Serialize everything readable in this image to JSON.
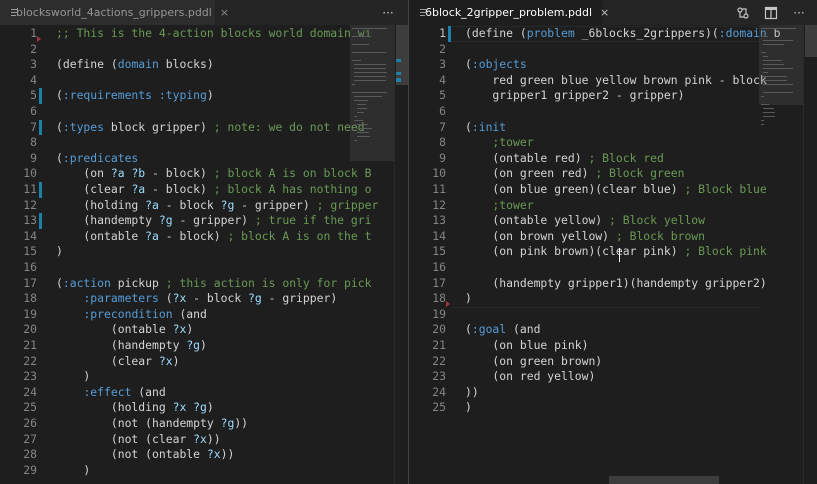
{
  "left_editor": {
    "tab": {
      "filename": "blocksworld_4actions_grippers.pddl",
      "close_icon": "×",
      "active": false
    },
    "more_actions": "···",
    "lines": [
      {
        "n": "1",
        "tokens": [
          {
            "t": ";; This is the 4-action blocks world domain wi",
            "c": "c"
          }
        ]
      },
      {
        "n": "2",
        "tokens": []
      },
      {
        "n": "3",
        "tokens": [
          {
            "t": "(define (",
            "c": ""
          },
          {
            "t": "domain",
            "c": "k"
          },
          {
            "t": " blocks)",
            "c": ""
          }
        ]
      },
      {
        "n": "4",
        "tokens": []
      },
      {
        "n": "5",
        "tokens": [
          {
            "t": "(",
            "c": ""
          },
          {
            "t": ":requirements",
            "c": "k"
          },
          {
            "t": " ",
            "c": ""
          },
          {
            "t": ":typing",
            "c": "k"
          },
          {
            "t": ")",
            "c": ""
          }
        ]
      },
      {
        "n": "6",
        "tokens": []
      },
      {
        "n": "7",
        "tokens": [
          {
            "t": "(",
            "c": ""
          },
          {
            "t": ":types",
            "c": "k"
          },
          {
            "t": " block gripper) ",
            "c": ""
          },
          {
            "t": "; note: we do not need",
            "c": "c"
          }
        ]
      },
      {
        "n": "8",
        "tokens": []
      },
      {
        "n": "9",
        "tokens": [
          {
            "t": "(",
            "c": ""
          },
          {
            "t": ":predicates",
            "c": "k"
          }
        ]
      },
      {
        "n": "10",
        "tokens": [
          {
            "t": "    (on ",
            "c": ""
          },
          {
            "t": "?a",
            "c": "s"
          },
          {
            "t": " ",
            "c": ""
          },
          {
            "t": "?b",
            "c": "s"
          },
          {
            "t": " - block) ",
            "c": ""
          },
          {
            "t": "; block A is on block B",
            "c": "c"
          }
        ]
      },
      {
        "n": "11",
        "tokens": [
          {
            "t": "    (clear ",
            "c": ""
          },
          {
            "t": "?a",
            "c": "s"
          },
          {
            "t": " - block) ",
            "c": ""
          },
          {
            "t": "; block A has nothing o",
            "c": "c"
          }
        ]
      },
      {
        "n": "12",
        "tokens": [
          {
            "t": "    (holding ",
            "c": ""
          },
          {
            "t": "?a",
            "c": "s"
          },
          {
            "t": " - block ",
            "c": ""
          },
          {
            "t": "?g",
            "c": "s"
          },
          {
            "t": " - gripper) ",
            "c": ""
          },
          {
            "t": "; gripper",
            "c": "c"
          }
        ]
      },
      {
        "n": "13",
        "tokens": [
          {
            "t": "    (handempty ",
            "c": ""
          },
          {
            "t": "?g",
            "c": "s"
          },
          {
            "t": " - gripper) ",
            "c": ""
          },
          {
            "t": "; true if the gri",
            "c": "c"
          }
        ]
      },
      {
        "n": "14",
        "tokens": [
          {
            "t": "    (ontable ",
            "c": ""
          },
          {
            "t": "?a",
            "c": "s"
          },
          {
            "t": " - block) ",
            "c": ""
          },
          {
            "t": "; block A is on the t",
            "c": "c"
          }
        ]
      },
      {
        "n": "15",
        "tokens": [
          {
            "t": ")",
            "c": ""
          }
        ]
      },
      {
        "n": "16",
        "tokens": []
      },
      {
        "n": "17",
        "tokens": [
          {
            "t": "(",
            "c": ""
          },
          {
            "t": ":action",
            "c": "k"
          },
          {
            "t": " pickup ",
            "c": ""
          },
          {
            "t": "; this action is only for pick",
            "c": "c"
          }
        ]
      },
      {
        "n": "18",
        "tokens": [
          {
            "t": "    ",
            "c": ""
          },
          {
            "t": ":parameters",
            "c": "k"
          },
          {
            "t": " (",
            "c": ""
          },
          {
            "t": "?x",
            "c": "s"
          },
          {
            "t": " - block ",
            "c": ""
          },
          {
            "t": "?g",
            "c": "s"
          },
          {
            "t": " - gripper)",
            "c": ""
          }
        ]
      },
      {
        "n": "19",
        "tokens": [
          {
            "t": "    ",
            "c": ""
          },
          {
            "t": ":precondition",
            "c": "k"
          },
          {
            "t": " (and",
            "c": ""
          }
        ]
      },
      {
        "n": "20",
        "tokens": [
          {
            "t": "        (ontable ",
            "c": ""
          },
          {
            "t": "?x",
            "c": "s"
          },
          {
            "t": ")",
            "c": ""
          }
        ]
      },
      {
        "n": "21",
        "tokens": [
          {
            "t": "        (handempty ",
            "c": ""
          },
          {
            "t": "?g",
            "c": "s"
          },
          {
            "t": ")",
            "c": ""
          }
        ]
      },
      {
        "n": "22",
        "tokens": [
          {
            "t": "        (clear ",
            "c": ""
          },
          {
            "t": "?x",
            "c": "s"
          },
          {
            "t": ")",
            "c": ""
          }
        ]
      },
      {
        "n": "23",
        "tokens": [
          {
            "t": "    )",
            "c": ""
          }
        ]
      },
      {
        "n": "24",
        "tokens": [
          {
            "t": "    ",
            "c": ""
          },
          {
            "t": ":effect",
            "c": "k"
          },
          {
            "t": " (and",
            "c": ""
          }
        ]
      },
      {
        "n": "25",
        "tokens": [
          {
            "t": "        (holding ",
            "c": ""
          },
          {
            "t": "?x",
            "c": "s"
          },
          {
            "t": " ",
            "c": ""
          },
          {
            "t": "?g",
            "c": "s"
          },
          {
            "t": ")",
            "c": ""
          }
        ]
      },
      {
        "n": "26",
        "tokens": [
          {
            "t": "        (not (handempty ",
            "c": ""
          },
          {
            "t": "?g",
            "c": "s"
          },
          {
            "t": "))",
            "c": ""
          }
        ]
      },
      {
        "n": "27",
        "tokens": [
          {
            "t": "        (not (clear ",
            "c": ""
          },
          {
            "t": "?x",
            "c": "s"
          },
          {
            "t": "))",
            "c": ""
          }
        ]
      },
      {
        "n": "28",
        "tokens": [
          {
            "t": "        (not (ontable ",
            "c": ""
          },
          {
            "t": "?x",
            "c": "s"
          },
          {
            "t": "))",
            "c": ""
          }
        ]
      },
      {
        "n": "29",
        "tokens": [
          {
            "t": "    )",
            "c": ""
          }
        ]
      }
    ]
  },
  "right_editor": {
    "tab": {
      "filename": "6block_2gripper_problem.pddl",
      "close_icon": "×",
      "active": true
    },
    "actions": {
      "open_changes_icon": "open-changes-icon",
      "split_editor_icon": "split-editor-icon",
      "more": "···"
    },
    "lines": [
      {
        "n": "1",
        "tokens": [
          {
            "t": "(define (",
            "c": ""
          },
          {
            "t": "problem",
            "c": "k"
          },
          {
            "t": " _6blocks_2grippers)(",
            "c": ""
          },
          {
            "t": ":domain",
            "c": "k"
          },
          {
            "t": " b",
            "c": ""
          }
        ]
      },
      {
        "n": "2",
        "tokens": []
      },
      {
        "n": "3",
        "tokens": [
          {
            "t": "(",
            "c": ""
          },
          {
            "t": ":objects",
            "c": "k"
          }
        ]
      },
      {
        "n": "4",
        "tokens": [
          {
            "t": "    red green blue yellow brown pink - block",
            "c": ""
          }
        ]
      },
      {
        "n": "5",
        "tokens": [
          {
            "t": "    gripper1 gripper2 - gripper)",
            "c": ""
          }
        ]
      },
      {
        "n": "6",
        "tokens": []
      },
      {
        "n": "7",
        "tokens": [
          {
            "t": "(",
            "c": ""
          },
          {
            "t": ":init",
            "c": "k"
          }
        ]
      },
      {
        "n": "8",
        "tokens": [
          {
            "t": "    ;tower",
            "c": "c"
          }
        ]
      },
      {
        "n": "9",
        "tokens": [
          {
            "t": "    (ontable red) ",
            "c": ""
          },
          {
            "t": "; Block red",
            "c": "c"
          }
        ]
      },
      {
        "n": "10",
        "tokens": [
          {
            "t": "    (on green red) ",
            "c": ""
          },
          {
            "t": "; Block green",
            "c": "c"
          }
        ]
      },
      {
        "n": "11",
        "tokens": [
          {
            "t": "    (on blue green)(clear blue) ",
            "c": ""
          },
          {
            "t": "; Block blue",
            "c": "c"
          }
        ]
      },
      {
        "n": "12",
        "tokens": [
          {
            "t": "    ;tower",
            "c": "c"
          }
        ]
      },
      {
        "n": "13",
        "tokens": [
          {
            "t": "    (ontable yellow) ",
            "c": ""
          },
          {
            "t": "; Block yellow",
            "c": "c"
          }
        ]
      },
      {
        "n": "14",
        "tokens": [
          {
            "t": "    (on brown yellow) ",
            "c": ""
          },
          {
            "t": "; Block brown",
            "c": "c"
          }
        ]
      },
      {
        "n": "15",
        "tokens": [
          {
            "t": "    (on pink brown)(clear pink) ",
            "c": ""
          },
          {
            "t": "; Block pink",
            "c": "c"
          }
        ]
      },
      {
        "n": "16",
        "tokens": []
      },
      {
        "n": "17",
        "tokens": [
          {
            "t": "    (handempty gripper1)(handempty gripper2)",
            "c": ""
          }
        ]
      },
      {
        "n": "18",
        "tokens": [
          {
            "t": ")",
            "c": ""
          }
        ]
      },
      {
        "n": "19",
        "tokens": []
      },
      {
        "n": "20",
        "tokens": [
          {
            "t": "(",
            "c": ""
          },
          {
            "t": ":goal",
            "c": "k"
          },
          {
            "t": " (and",
            "c": ""
          }
        ]
      },
      {
        "n": "21",
        "tokens": [
          {
            "t": "    (on blue pink)",
            "c": ""
          }
        ]
      },
      {
        "n": "22",
        "tokens": [
          {
            "t": "    (on green brown)",
            "c": ""
          }
        ]
      },
      {
        "n": "23",
        "tokens": [
          {
            "t": "    (on red yellow)",
            "c": ""
          }
        ]
      },
      {
        "n": "24",
        "tokens": [
          {
            "t": "))",
            "c": ""
          }
        ]
      },
      {
        "n": "25",
        "tokens": [
          {
            "t": ")",
            "c": ""
          }
        ]
      }
    ]
  },
  "colors": {
    "background": "#1e1e1e",
    "tabbar": "#252526",
    "keyword": "#569cd6",
    "variable": "#9cdcfe",
    "comment": "#6a9955",
    "line_number": "#858585",
    "modified_gutter": "#1b81a8",
    "deleted_gutter": "#a4343d"
  }
}
